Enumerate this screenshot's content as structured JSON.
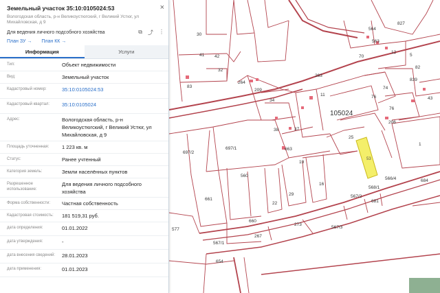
{
  "panel": {
    "title": "Земельный участок 35:10:0105024:53",
    "address": "Вологодская область, р-н Великоустюгский, г Великий Устюг, ул Михайловская, д 9",
    "purpose": "Для ведения личного подсобного хозяйства",
    "close_icon": "×",
    "action_icons": [
      "layers-icon",
      "share-icon",
      "more-icon"
    ],
    "link_plan_zu": "План ЗУ →",
    "link_plan_kk": "План КК →",
    "tabs": [
      "Информация",
      "Услуги"
    ]
  },
  "info": [
    {
      "label": "Тип:",
      "value": "Объект недвижимости"
    },
    {
      "label": "Вид:",
      "value": "Земельный участок"
    },
    {
      "label": "Кадастровый номер:",
      "value": "35:10:0105024:53",
      "link": true
    },
    {
      "label": "Кадастровый квартал:",
      "value": "35:10:0105024",
      "link": true
    },
    {
      "label": "Адрес:",
      "value": "Вологодская область, р-н Великоустюгский, г Великий Устюг, ул Михайловская, д 9"
    },
    {
      "label": "Площадь уточненная:",
      "value": "1 223 кв. м"
    },
    {
      "label": "Статус:",
      "value": "Ранее учтенный"
    },
    {
      "label": "Категория земель:",
      "value": "Земли населённых пунктов"
    },
    {
      "label": "Разрешенное использование:",
      "value": "Для ведения личного подсобного хозяйства"
    },
    {
      "label": "Форма собственности:",
      "value": "Частная собственность"
    },
    {
      "label": "Кадастровая стоимость:",
      "value": "181 519,31 руб."
    },
    {
      "label": "дата определения:",
      "value": "01.01.2022"
    },
    {
      "label": "дата утверждения:",
      "value": "-"
    },
    {
      "label": "дата внесения сведений:",
      "value": "28.01.2023"
    },
    {
      "label": "дата применения:",
      "value": "01.01.2023"
    }
  ],
  "map": {
    "quarter_label": "105024",
    "selected_parcel": "53",
    "parcel_labels": [
      "30",
      "41",
      "42",
      "32",
      "83",
      "264",
      "34",
      "11",
      "74",
      "209",
      "38",
      "37",
      "663",
      "25",
      "19",
      "16",
      "697/2",
      "697/1",
      "560",
      "661",
      "22",
      "29",
      "1",
      "660",
      "267",
      "273",
      "577",
      "567/1",
      "654",
      "567/3",
      "684",
      "567/2",
      "568/1",
      "566/4",
      "681",
      "76",
      "206",
      "839",
      "827",
      "563",
      "12",
      "5",
      "43",
      "564",
      "263",
      "70",
      "76",
      "82"
    ],
    "colors": {
      "parcel_line": "#b3434d",
      "selected_fill": "#f4ef6a",
      "selected_stroke": "#c9b81c",
      "map_bg": "#ffffff",
      "building": "#e56a7a"
    }
  }
}
